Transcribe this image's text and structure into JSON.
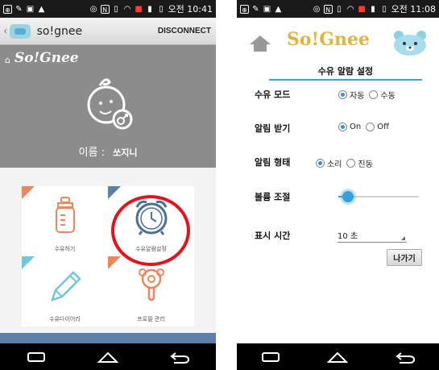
{
  "left_screen": {
    "status": {
      "clock": "오전 10:41"
    },
    "actionbar": {
      "back": "‹",
      "title": "so!gnee",
      "disconnect_label": "DISCONNECT"
    },
    "profile": {
      "brand": "So!Gnee",
      "name_label": "이름 :",
      "name_value": "쏘지니"
    },
    "menu": [
      {
        "label": "수유하기",
        "corner_color": "#f0855a"
      },
      {
        "label": "수유알람설정",
        "corner_color": "#5b7fa8"
      },
      {
        "label": "수유다이어리",
        "corner_color": "#6ec7de"
      },
      {
        "label": "프로필 관리",
        "corner_color": "#f0855a"
      }
    ]
  },
  "right_screen": {
    "status": {
      "clock": "오전 11:08"
    },
    "brand": "So!Gnee",
    "page_title": "수유 알람 설정",
    "settings": {
      "mode": {
        "label": "수유 모드",
        "options": [
          "자동",
          "수동"
        ],
        "selected": "자동"
      },
      "receive": {
        "label": "알림 받기",
        "options": [
          "On",
          "Off"
        ],
        "selected": "On"
      },
      "type": {
        "label": "알림 형태",
        "options": [
          "소리",
          "진동"
        ],
        "selected": "소리"
      },
      "volume": {
        "label": "볼륨 조절",
        "level": 0.05
      },
      "display_time": {
        "label": "표시 시간",
        "value": "10 초"
      }
    },
    "exit_label": "나가기"
  },
  "colors": {
    "accent_blue": "#3aa0dc",
    "profile_gray": "#8c8c8c",
    "brand_gold": "#e5b23e",
    "highlight_red": "#e8101a"
  }
}
